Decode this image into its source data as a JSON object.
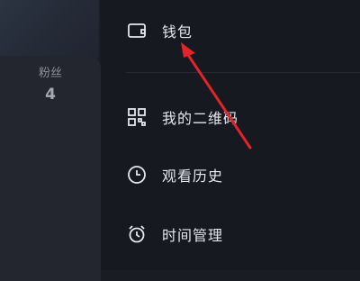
{
  "profile": {
    "fans_label": "粉丝",
    "fans_count": "4"
  },
  "menu": {
    "items": [
      {
        "label": "钱包",
        "icon": "wallet-icon"
      },
      {
        "label": "我的二维码",
        "icon": "qr-code-icon"
      },
      {
        "label": "观看历史",
        "icon": "clock-icon"
      },
      {
        "label": "时间管理",
        "icon": "alarm-clock-icon"
      }
    ]
  },
  "colors": {
    "annotation_arrow": "#e0242a",
    "drawer_bg": "#171920",
    "text": "#e6e7ea"
  }
}
